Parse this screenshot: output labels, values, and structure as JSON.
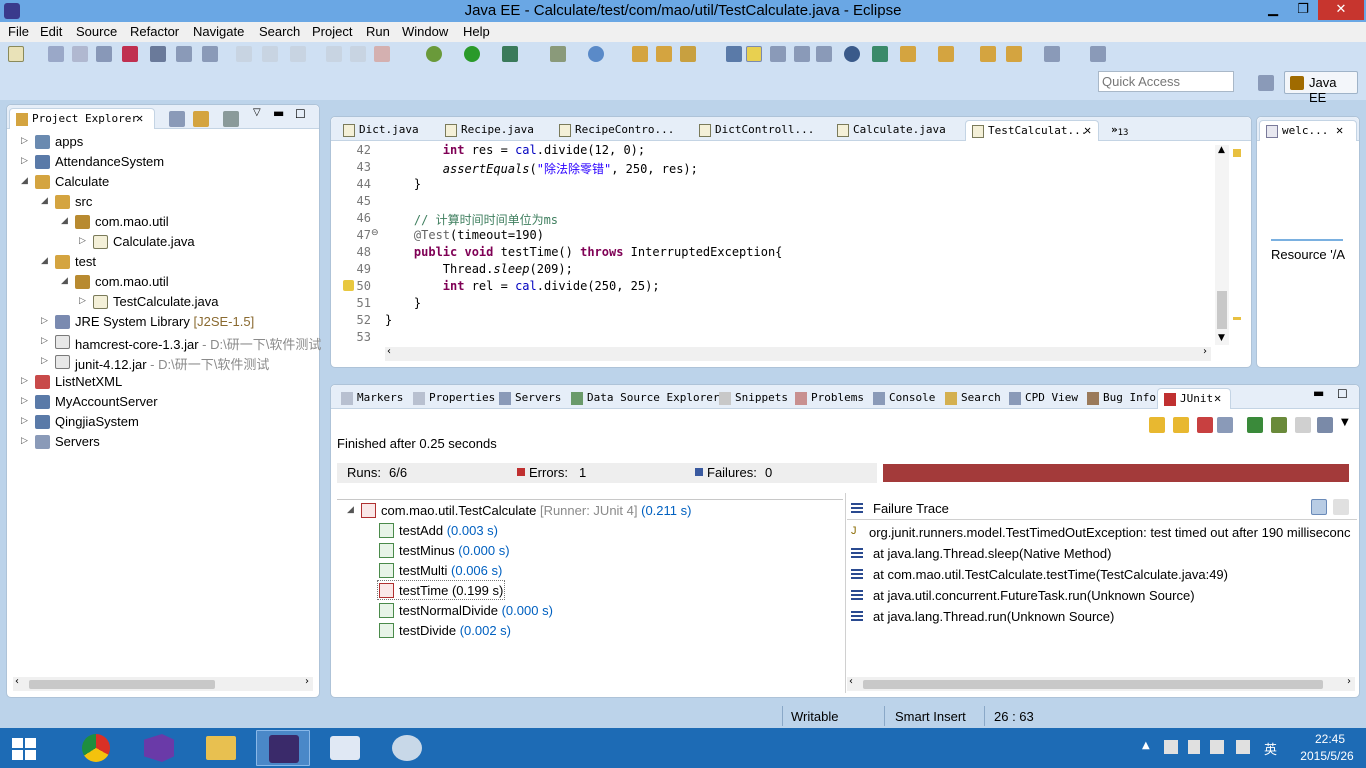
{
  "window": {
    "title": "Java EE - Calculate/test/com/mao/util/TestCalculate.java - Eclipse",
    "min": "▁",
    "max": "❐",
    "close": "✕"
  },
  "menu": [
    "File",
    "Edit",
    "Source",
    "Refactor",
    "Navigate",
    "Search",
    "Project",
    "Run",
    "Window",
    "Help"
  ],
  "toolbar": {
    "quick_access_placeholder": "Quick Access",
    "perspective": "Java EE"
  },
  "project_explorer": {
    "title": "Project Explorer",
    "items": [
      {
        "label": "apps",
        "twisty": "▷"
      },
      {
        "label": "AttendanceSystem",
        "twisty": "▷"
      },
      {
        "label": "Calculate",
        "twisty": "◢"
      },
      {
        "label": "src",
        "twisty": "◢"
      },
      {
        "label": "com.mao.util",
        "twisty": "◢"
      },
      {
        "label": "Calculate.java",
        "twisty": "▷"
      },
      {
        "label": "test",
        "twisty": "◢"
      },
      {
        "label": "com.mao.util",
        "twisty": "◢"
      },
      {
        "label": "TestCalculate.java",
        "twisty": "▷"
      },
      {
        "label": "JRE System Library",
        "suffix": " [J2SE-1.5]",
        "twisty": "▷"
      },
      {
        "label": "hamcrest-core-1.3.jar",
        "suffix": " - D:\\研一下\\软件测试",
        "twisty": "▷"
      },
      {
        "label": "junit-4.12.jar",
        "suffix": " - D:\\研一下\\软件测试",
        "twisty": "▷"
      },
      {
        "label": "ListNetXML",
        "twisty": "▷"
      },
      {
        "label": "MyAccountServer",
        "twisty": "▷"
      },
      {
        "label": "QingjiaSystem",
        "twisty": "▷"
      },
      {
        "label": "Servers",
        "twisty": "▷"
      }
    ]
  },
  "editor": {
    "tabs": [
      "Dict.java",
      "Recipe.java",
      "RecipeContro...",
      "DictControll...",
      "Calculate.java",
      "TestCalculat..."
    ],
    "overflow": "»",
    "overflow_count": "13",
    "lines": [
      {
        "n": "42",
        "segments": [
          {
            "t": "        "
          },
          {
            "t": "int",
            "c": "kw"
          },
          {
            "t": " res = "
          },
          {
            "t": "cal",
            "c": "fld"
          },
          {
            "t": ".divide(12, 0);"
          }
        ]
      },
      {
        "n": "43",
        "segments": [
          {
            "t": "        "
          },
          {
            "t": "assertEquals",
            "c": "ital"
          },
          {
            "t": "("
          },
          {
            "t": "\"除法除零错\"",
            "c": "str"
          },
          {
            "t": ", 250, res);"
          }
        ]
      },
      {
        "n": "44",
        "segments": [
          {
            "t": "    }"
          }
        ]
      },
      {
        "n": "45",
        "segments": [
          {
            "t": ""
          }
        ]
      },
      {
        "n": "46",
        "segments": [
          {
            "t": "    "
          },
          {
            "t": "// 计算时间时间单位为ms",
            "c": "cmt"
          }
        ]
      },
      {
        "n": "47",
        "segments": [
          {
            "t": "    "
          },
          {
            "t": "@Test",
            "c": "ann"
          },
          {
            "t": "(timeout=190)"
          }
        ]
      },
      {
        "n": "48",
        "segments": [
          {
            "t": "    "
          },
          {
            "t": "public void",
            "c": "kw"
          },
          {
            "t": " testTime() "
          },
          {
            "t": "throws",
            "c": "kw"
          },
          {
            "t": " InterruptedException{"
          }
        ]
      },
      {
        "n": "49",
        "segments": [
          {
            "t": "        Thread."
          },
          {
            "t": "sleep",
            "c": "ital"
          },
          {
            "t": "(209);"
          }
        ]
      },
      {
        "n": "50",
        "segments": [
          {
            "t": "        "
          },
          {
            "t": "int",
            "c": "kw"
          },
          {
            "t": " rel = "
          },
          {
            "t": "cal",
            "c": "fld"
          },
          {
            "t": ".divide(250, 25);"
          }
        ]
      },
      {
        "n": "51",
        "segments": [
          {
            "t": "    }"
          }
        ]
      },
      {
        "n": "52",
        "segments": [
          {
            "t": "}"
          }
        ]
      },
      {
        "n": "53",
        "segments": [
          {
            "t": ""
          }
        ]
      }
    ]
  },
  "side_panel": {
    "tab": "welc...",
    "resource": "Resource '/A"
  },
  "bottom_tabs": [
    "Markers",
    "Properties",
    "Servers",
    "Data Source Explorer",
    "Snippets",
    "Problems",
    "Console",
    "Search",
    "CPD View",
    "Bug Info",
    "JUnit"
  ],
  "junit": {
    "finished": "Finished after 0.25 seconds",
    "runs_label": "Runs:",
    "runs": "6/6",
    "errors_label": "Errors:",
    "errors": "1",
    "failures_label": "Failures:",
    "failures": "0",
    "bar_color": "#a33a3a",
    "root": {
      "name": "com.mao.util.TestCalculate",
      "runner": " [Runner: JUnit 4]",
      "time": " (0.211 s)"
    },
    "tests": [
      {
        "name": "testAdd",
        "time": " (0.003 s)",
        "status": "pass"
      },
      {
        "name": "testMinus",
        "time": " (0.000 s)",
        "status": "pass"
      },
      {
        "name": "testMulti",
        "time": " (0.006 s)",
        "status": "pass"
      },
      {
        "name": "testTime",
        "time": " (0.199 s)",
        "status": "error"
      },
      {
        "name": "testNormalDivide",
        "time": " (0.000 s)",
        "status": "pass"
      },
      {
        "name": "testDivide",
        "time": " (0.002 s)",
        "status": "pass"
      }
    ],
    "trace_title": "Failure Trace",
    "trace": [
      "org.junit.runners.model.TestTimedOutException: test timed out after 190 milliseconc",
      "at java.lang.Thread.sleep(Native Method)",
      "at com.mao.util.TestCalculate.testTime(TestCalculate.java:49)",
      "at java.util.concurrent.FutureTask.run(Unknown Source)",
      "at java.lang.Thread.run(Unknown Source)"
    ]
  },
  "status": {
    "writable": "Writable",
    "insert": "Smart Insert",
    "position": "26 : 63"
  },
  "taskbar": {
    "time": "22:45",
    "date": "2015/5/26",
    "ime": "英"
  }
}
